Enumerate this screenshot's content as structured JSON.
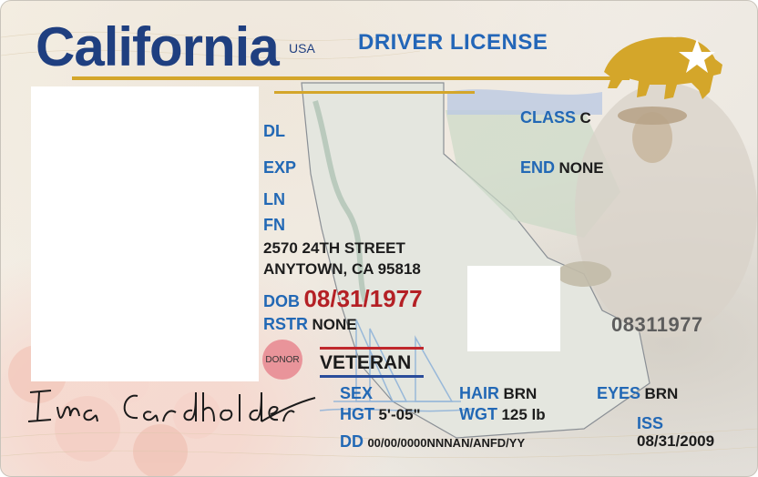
{
  "header": {
    "state_name": "California",
    "country": "USA",
    "doc_title": "DRIVER LICENSE"
  },
  "fields": {
    "class_label": "CLASS",
    "class_value": "C",
    "end_label": "END",
    "end_value": "NONE",
    "dl_label": "DL",
    "exp_label": "EXP",
    "ln_label": "LN",
    "fn_label": "FN",
    "address_line1": "2570 24TH STREET",
    "address_line2": "ANYTOWN, CA 95818",
    "dob_label": "DOB",
    "dob_value": "08/31/1977",
    "rstr_label": "RSTR",
    "rstr_value": "NONE",
    "donor_label": "DONOR",
    "veteran_label": "VETERAN",
    "sex_label": "SEX",
    "hgt_label": "HGT",
    "hgt_value": "5'-05\"",
    "hair_label": "HAIR",
    "hair_value": "BRN",
    "wgt_label": "WGT",
    "wgt_value": "125 lb",
    "eyes_label": "EYES",
    "eyes_value": "BRN",
    "iss_label": "ISS",
    "iss_value": "08/31/2009",
    "dd_label": "DD",
    "dd_value": "00/00/0000NNNAN/ANFD/YY",
    "ghost_number": "08311977"
  },
  "signature": "Ima Cardholder",
  "colors": {
    "brand_blue": "#1f3f80",
    "label_blue": "#2268b5",
    "dob_red": "#b42025",
    "gold": "#d4a62a",
    "donor_pink": "#e9949a"
  }
}
